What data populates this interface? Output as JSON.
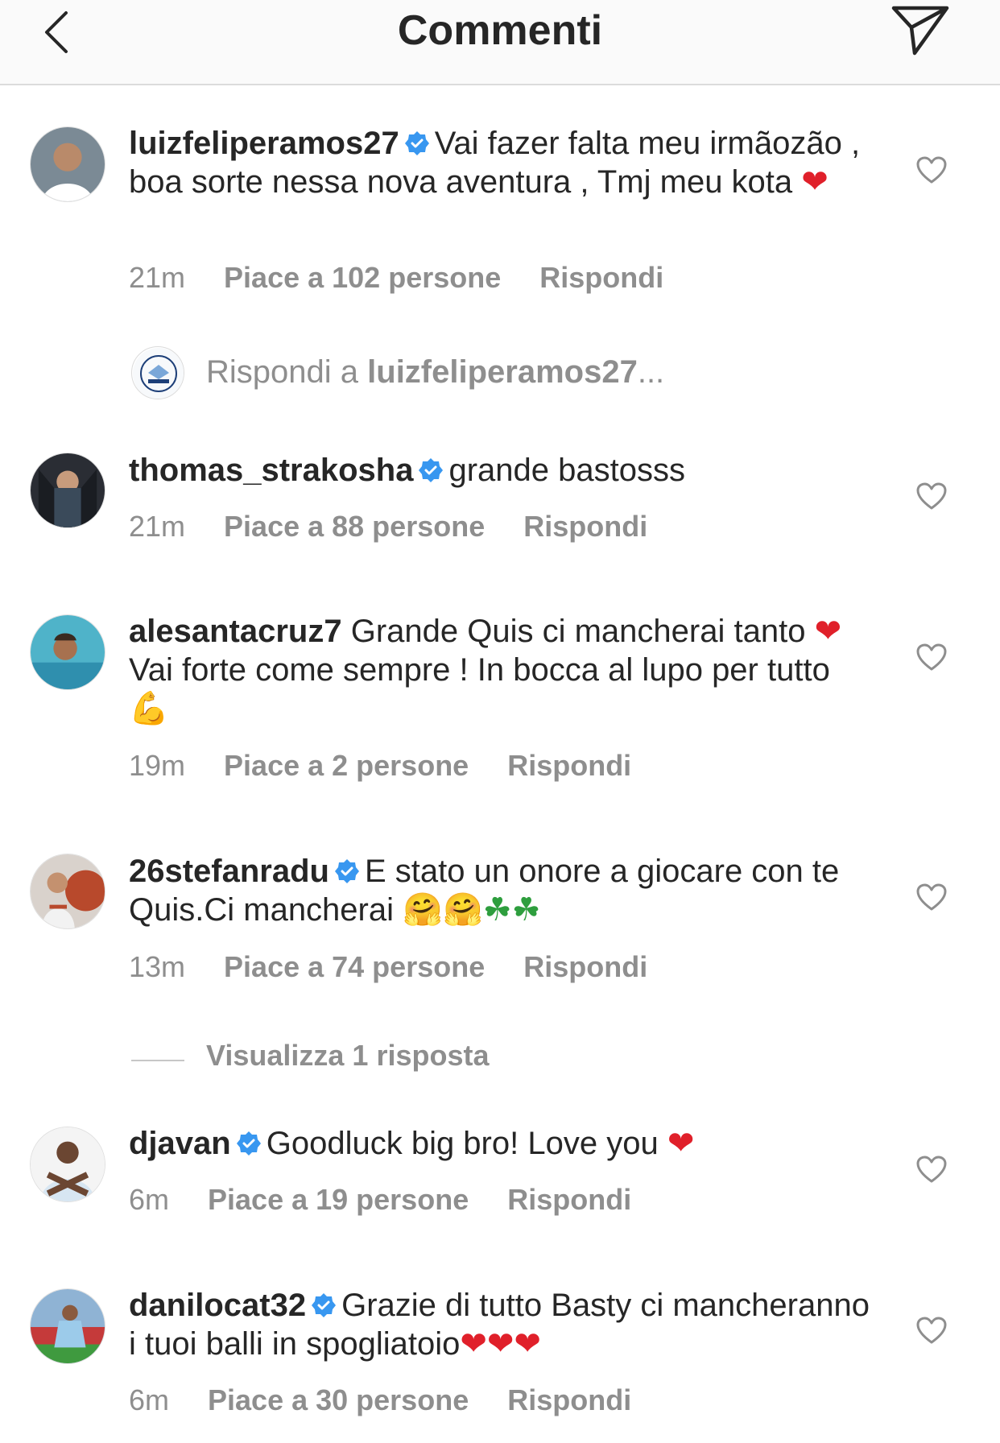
{
  "header": {
    "title": "Commenti",
    "back_icon": "chevron-left-icon",
    "send_icon": "paper-plane-icon"
  },
  "colors": {
    "verified": "#3897f0",
    "meta": "#8e8e8e",
    "text": "#262626",
    "heart": "#e0202a"
  },
  "comments": [
    {
      "username": "luizfeliperamos27",
      "verified": true,
      "text": "Vai fazer falta meu irmãozão , boa sorte nessa nova aventura , Tmj meu kota",
      "emojis": "❤",
      "time": "21m",
      "likes": "Piace a 102 persone",
      "reply": "Rispondi"
    },
    {
      "username": "thomas_strakosha",
      "verified": true,
      "text": "grande bastosss",
      "emojis": "",
      "time": "21m",
      "likes": "Piace a 88 persone",
      "reply": "Rispondi"
    },
    {
      "username": "alesantacruz7",
      "verified": false,
      "text_a": "Grande Quis ci mancherai tanto",
      "emoji_a": "❤",
      "text_b": "Vai forte come sempre ! In bocca al lupo per tutto",
      "emoji_b": "💪",
      "time": "19m",
      "likes": "Piace a 2 persone",
      "reply": "Rispondi"
    },
    {
      "username": "26stefanradu",
      "verified": true,
      "text": "E stato un onore a giocare con te Quis.Ci mancherai",
      "emojis": "🤗🤗☘☘",
      "time": "13m",
      "likes": "Piace a 74 persone",
      "reply": "Rispondi"
    },
    {
      "username": "djavan",
      "verified": true,
      "text": "Goodluck big bro! Love you",
      "emojis": "❤",
      "time": "6m",
      "likes": "Piace a 19 persone",
      "reply": "Rispondi"
    },
    {
      "username": "danilocat32",
      "verified": true,
      "text": "Grazie di tutto Basty ci mancheranno i tuoi balli in spogliatoio",
      "emojis": "❤❤❤",
      "time": "6m",
      "likes": "Piace a 30 persone",
      "reply": "Rispondi"
    }
  ],
  "reply_prompt": {
    "prefix": "Rispondi a",
    "user": "luizfeliperamos27",
    "suffix": "..."
  },
  "view_replies": "Visualizza 1 risposta"
}
